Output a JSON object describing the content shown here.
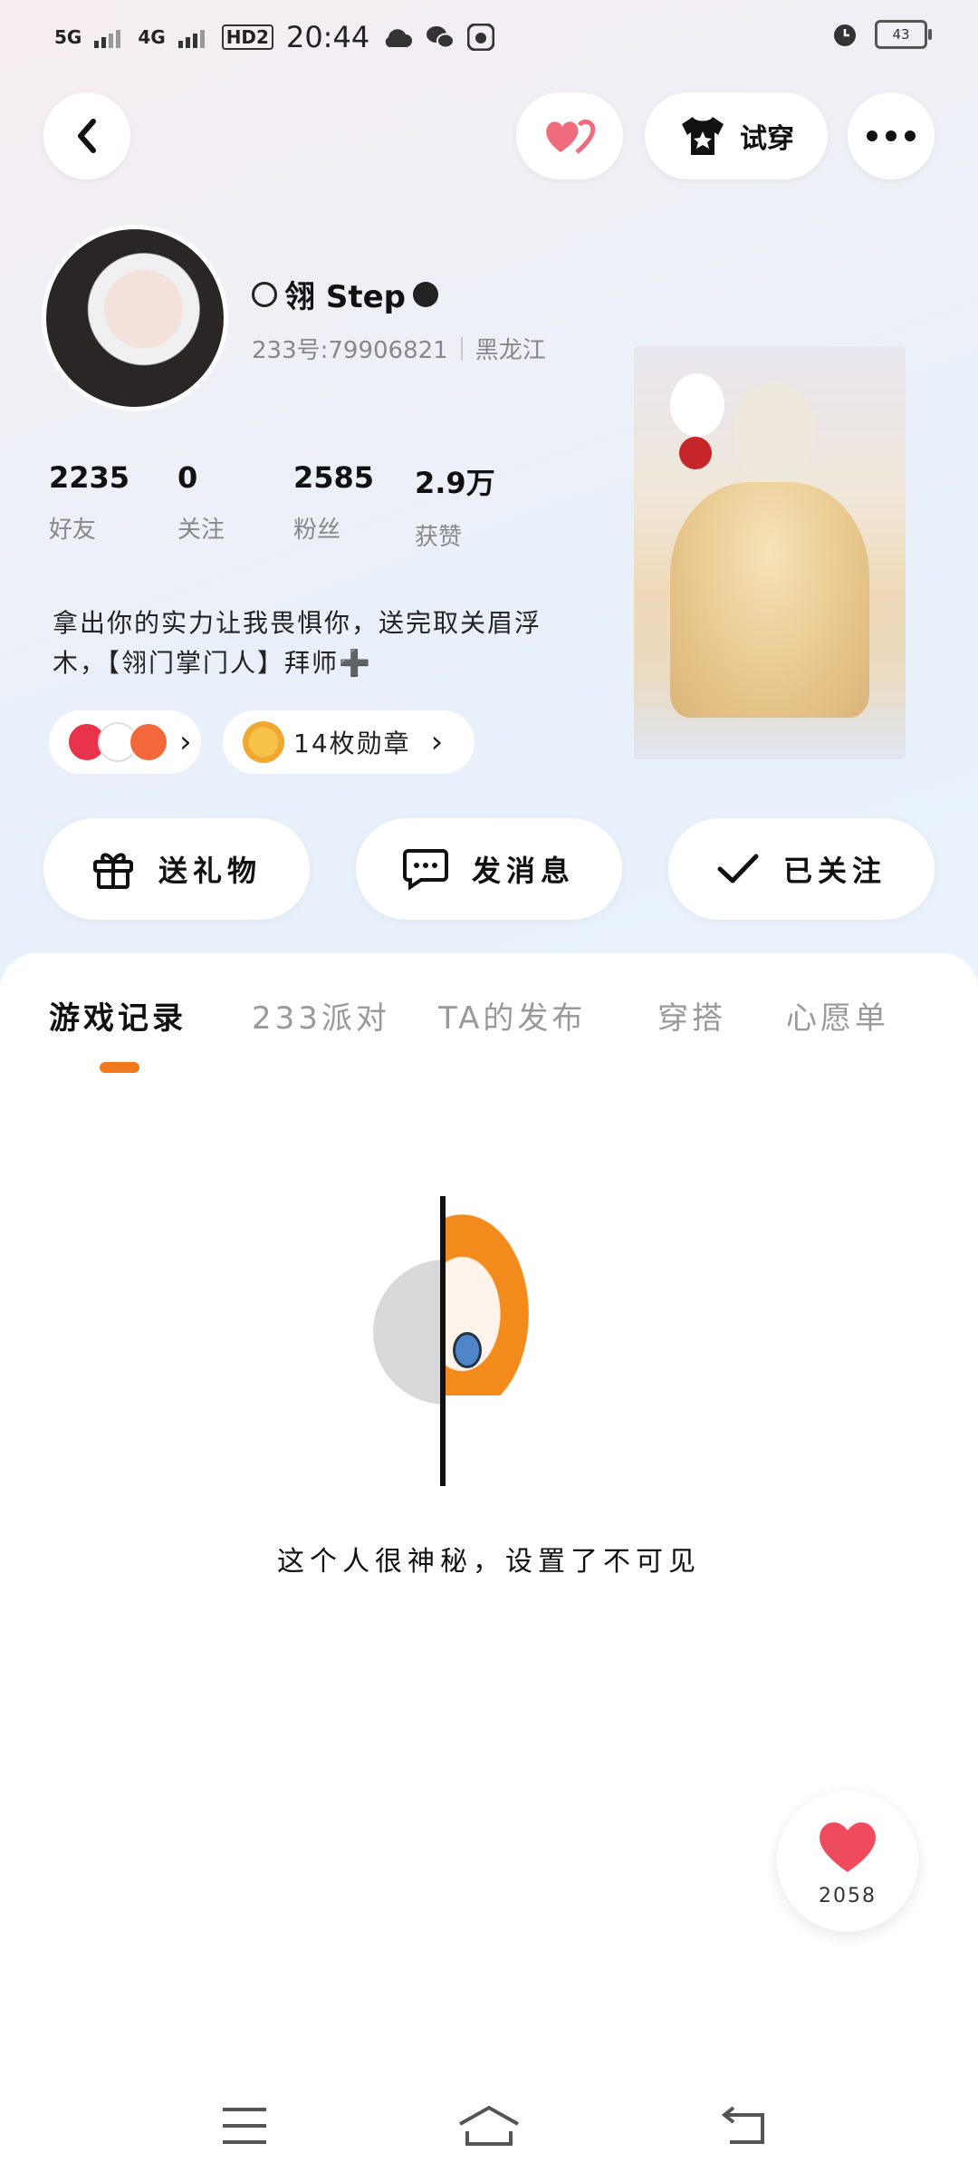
{
  "status_bar": {
    "network_1": "5G",
    "network_2": "4G",
    "hd": "HD2",
    "time": "20:44",
    "battery": "43"
  },
  "header": {
    "try_on_label": "试穿"
  },
  "profile": {
    "name": "翎 Step",
    "id_label": "233号:79906821",
    "location": "黑龙江",
    "stats": [
      {
        "value": "2235",
        "label": "好友"
      },
      {
        "value": "0",
        "label": "关注"
      },
      {
        "value": "2585",
        "label": "粉丝"
      },
      {
        "value": "2.9万",
        "label": "获赞"
      }
    ],
    "bio_line1": "拿出你的实力让我畏惧你，送完取关眉浮",
    "bio_line2": "木，【翎门掌门人】拜师➕",
    "badge_count": "14枚勋章"
  },
  "actions": {
    "gift": "送礼物",
    "message": "发消息",
    "followed": "已关注"
  },
  "tabs": [
    {
      "label": "游戏记录"
    },
    {
      "label": "233派对"
    },
    {
      "label": "TA的发布"
    },
    {
      "label": "穿搭"
    },
    {
      "label": "心愿单"
    }
  ],
  "empty_state": {
    "text": "这个人很神秘，设置了不可见"
  },
  "like": {
    "count": "2058"
  },
  "colors": {
    "accent": "#f07a1c",
    "heart": "#ee4b5c"
  }
}
